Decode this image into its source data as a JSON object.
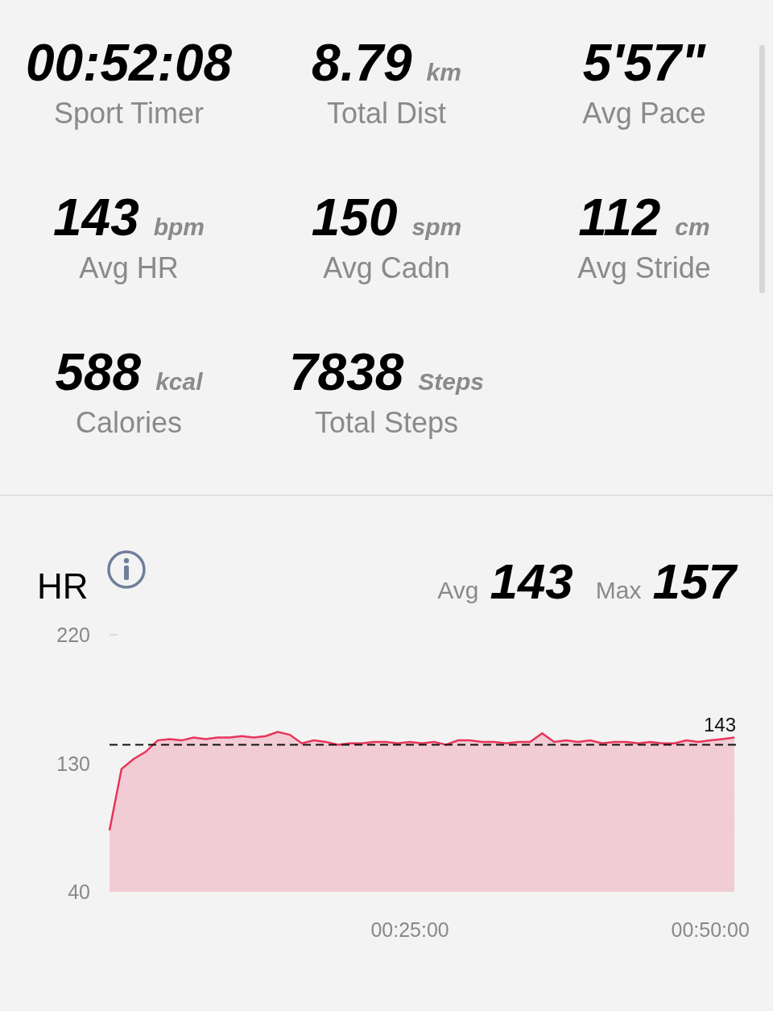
{
  "stats": [
    {
      "value": "00:52:08",
      "label": "Sport Timer"
    },
    {
      "value": "8.79",
      "unit": "km",
      "label": "Total Dist"
    },
    {
      "value": "5'57\"",
      "label": "Avg Pace"
    },
    {
      "value": "143",
      "unit": "bpm",
      "label": "Avg HR"
    },
    {
      "value": "150",
      "unit": "spm",
      "label": "Avg Cadn"
    },
    {
      "value": "112",
      "unit": "cm",
      "label": "Avg Stride"
    },
    {
      "value": "588",
      "unit": "kcal",
      "label": "Calories"
    },
    {
      "value": "7838",
      "unit": "Steps",
      "label": "Total Steps"
    }
  ],
  "hr": {
    "title": "HR",
    "avg_label": "Avg",
    "avg_value": "143",
    "max_label": "Max",
    "max_value": "157",
    "chart_data": {
      "type": "area",
      "ylim": [
        40,
        220
      ],
      "yticks": [
        40,
        130,
        220
      ],
      "xlim": [
        0,
        52.13
      ],
      "xticks": [
        {
          "value": 25,
          "label": "00:25:00"
        },
        {
          "value": 50,
          "label": "00:50:00"
        }
      ],
      "x": [
        0,
        1,
        2,
        3,
        4,
        5,
        6,
        7,
        8,
        9,
        10,
        11,
        12,
        13,
        14,
        15,
        16,
        17,
        18,
        19,
        20,
        21,
        22,
        23,
        24,
        25,
        26,
        27,
        28,
        29,
        30,
        31,
        32,
        33,
        34,
        35,
        36,
        37,
        38,
        39,
        40,
        41,
        42,
        43,
        44,
        45,
        46,
        47,
        48,
        49,
        50,
        51,
        52
      ],
      "series": [
        {
          "color": "#e8345a",
          "values": [
            83,
            126,
            133,
            138,
            146,
            147,
            146,
            148,
            147,
            148,
            148,
            149,
            148,
            149,
            152,
            150,
            144,
            146,
            145,
            143,
            144,
            144,
            145,
            145,
            144,
            145,
            144,
            145,
            143,
            146,
            146,
            145,
            145,
            144,
            145,
            145,
            151,
            145,
            146,
            145,
            146,
            144,
            145,
            145,
            144,
            145,
            144,
            144,
            146,
            145,
            146,
            147,
            148
          ]
        },
        {
          "type": "line",
          "line_style": "dashed",
          "color": "#111111",
          "values": [
            143,
            143,
            143,
            143,
            143,
            143,
            143,
            143,
            143,
            143,
            143,
            143,
            143,
            143,
            143,
            143,
            143,
            143,
            143,
            143,
            143,
            143,
            143,
            143,
            143,
            143,
            143,
            143,
            143,
            143,
            143,
            143,
            143,
            143,
            143,
            143,
            143,
            143,
            143,
            143,
            143,
            143,
            143,
            143,
            143,
            143,
            143,
            143,
            143,
            143,
            143,
            143,
            143
          ]
        }
      ],
      "annotations": [
        {
          "text": "143",
          "x": 52.13,
          "y": 143
        }
      ]
    }
  }
}
